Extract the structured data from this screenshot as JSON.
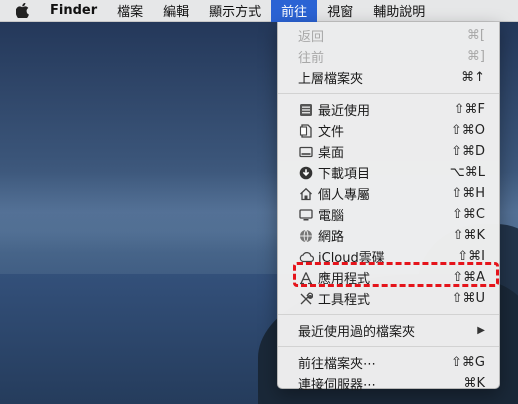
{
  "menubar": {
    "apple_icon": "apple-logo-icon",
    "app_name": "Finder",
    "items": [
      "檔案",
      "編輯",
      "顯示方式",
      "前往",
      "視窗",
      "輔助說明"
    ],
    "active": "前往"
  },
  "go_menu": {
    "back": {
      "label": "返回",
      "shortcut": "⌘["
    },
    "forward": {
      "label": "往前",
      "shortcut": "⌘]"
    },
    "enclosing": {
      "label": "上層檔案夾",
      "shortcut": "⌘↑"
    },
    "recents": {
      "label": "最近使用",
      "shortcut": "⇧⌘F",
      "icon": "recents-icon"
    },
    "documents": {
      "label": "文件",
      "shortcut": "⇧⌘O",
      "icon": "documents-icon"
    },
    "desktop": {
      "label": "桌面",
      "shortcut": "⇧⌘D",
      "icon": "desktop-icon"
    },
    "downloads": {
      "label": "下載項目",
      "shortcut": "⌥⌘L",
      "icon": "downloads-icon"
    },
    "home": {
      "label": "個人專屬",
      "shortcut": "⇧⌘H",
      "icon": "home-icon"
    },
    "computer": {
      "label": "電腦",
      "shortcut": "⇧⌘C",
      "icon": "computer-icon"
    },
    "network": {
      "label": "網路",
      "shortcut": "⇧⌘K",
      "icon": "network-icon"
    },
    "icloud": {
      "label": "iCloud雲碟",
      "shortcut": "⇧⌘I",
      "icon": "cloud-icon"
    },
    "applications": {
      "label": "應用程式",
      "shortcut": "⇧⌘A",
      "icon": "applications-icon"
    },
    "utilities": {
      "label": "工具程式",
      "shortcut": "⇧⌘U",
      "icon": "utilities-icon"
    },
    "recent_folders": {
      "label": "最近使用過的檔案夾"
    },
    "goto_folder": {
      "label": "前往檔案夾⋯",
      "shortcut": "⇧⌘G"
    },
    "connect_server": {
      "label": "連接伺服器⋯",
      "shortcut": "⌘K"
    }
  },
  "colors": {
    "active_menu": "#2b63d4",
    "highlight": "#e5141b"
  }
}
